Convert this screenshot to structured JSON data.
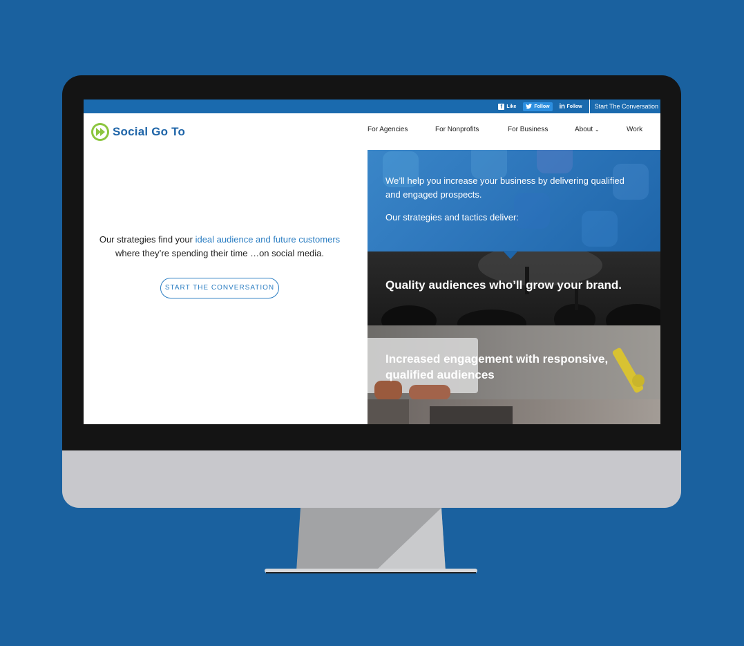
{
  "topbar": {
    "facebook_label": "Like",
    "twitter_label": "Follow",
    "linkedin_label": "Follow",
    "cta_label": "Start The Conversation"
  },
  "brand": {
    "name": "Social Go To",
    "primary_color": "#1f65a8",
    "accent_color": "#8cc63f",
    "icon": "play-forward-icon"
  },
  "nav": {
    "items": [
      {
        "label": "For Agencies"
      },
      {
        "label": "For Nonprofits"
      },
      {
        "label": "For Business"
      },
      {
        "label": "About"
      },
      {
        "label": "Work"
      }
    ]
  },
  "hero": {
    "line1_prefix": "Our strategies find your ",
    "line1_accent": "ideal audience and future customers",
    "line2": "where they’re spending their time …on social media.",
    "button_label": "START THE CONVERSATION"
  },
  "right": {
    "intro_1": "We’ll help you increase your business by delivering qualified and engaged prospects.",
    "intro_2": "Our strategies and tactics deliver:",
    "panel_1": "Quality audiences who’ll grow your brand.",
    "panel_2": "Increased engagement with responsive, qualified audiences"
  },
  "colors": {
    "page_background": "#1a619f",
    "topbar": "#1a6aae",
    "link_blue": "#2a7dc2"
  }
}
